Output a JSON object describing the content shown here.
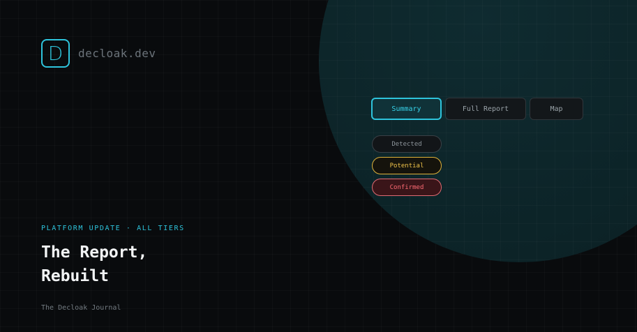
{
  "brand": {
    "mark_letter": "D",
    "name": "decloak.dev"
  },
  "tabs": [
    {
      "label": "Summary",
      "active": true
    },
    {
      "label": "Full Report",
      "active": false
    },
    {
      "label": "Map",
      "active": false
    }
  ],
  "status_pills": [
    {
      "label": "Detected",
      "color": "#8c949a"
    },
    {
      "label": "Potential",
      "color": "#f1c44a"
    },
    {
      "label": "Confirmed",
      "color": "#ff6b74"
    }
  ],
  "article": {
    "kicker": "PLATFORM UPDATE · ALL TIERS",
    "headline_line1": "The Report,",
    "headline_line2": "Rebuilt",
    "publication": "The Decloak Journal"
  },
  "colors": {
    "accent": "#2ec4dc",
    "background": "#090b0d",
    "circle": "#0c2327"
  }
}
